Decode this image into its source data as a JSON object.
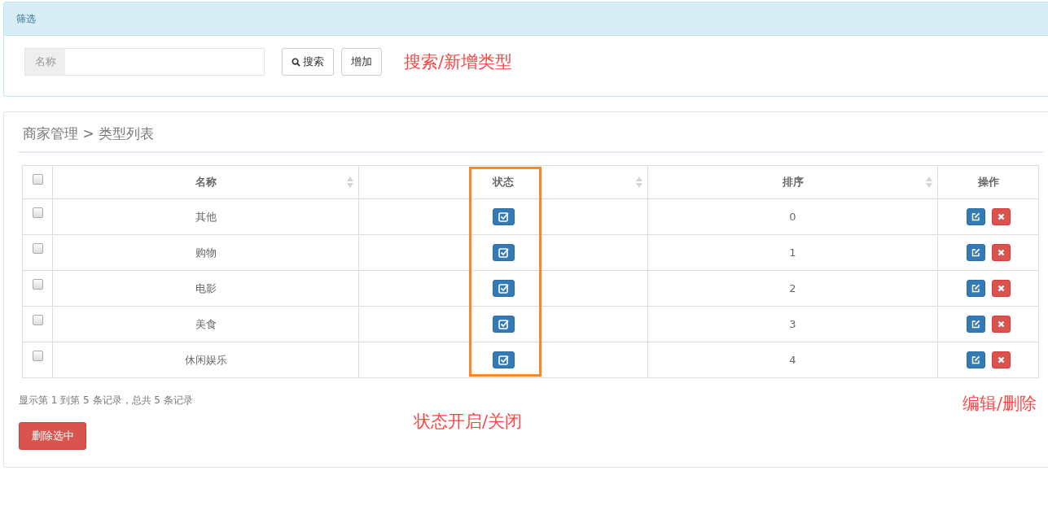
{
  "filter_panel": {
    "title": "筛选",
    "name_field": {
      "label": "名称"
    },
    "buttons": [
      {
        "kind": "search",
        "label": "搜索"
      },
      {
        "kind": "plain",
        "label": "增加"
      }
    ],
    "annotation": "搜索/新增类型"
  },
  "list_panel": {
    "breadcrumb": "商家管理 > 类型列表",
    "table": {
      "select_all": {
        "checked": false
      },
      "columns": [
        {
          "label": "名称",
          "sortable": true
        },
        {
          "label": "状态",
          "sortable": true
        },
        {
          "label": "排序",
          "sortable": true
        },
        {
          "label": "操作",
          "sortable": false
        }
      ],
      "rows": [
        {
          "checked": false,
          "name": "其他",
          "status_on": true,
          "sort": "0"
        },
        {
          "checked": false,
          "name": "购物",
          "status_on": true,
          "sort": "1"
        },
        {
          "checked": false,
          "name": "电影",
          "status_on": true,
          "sort": "2"
        },
        {
          "checked": false,
          "name": "美食",
          "status_on": true,
          "sort": "3"
        },
        {
          "checked": false,
          "name": "休闲娱乐",
          "status_on": true,
          "sort": "4"
        }
      ]
    },
    "summary": "显示第 1 到第 5 条记录，总共 5 条记录",
    "delete_button": "删除选中",
    "status_annotation": "状态开启/关闭",
    "actions_annotation": "编辑/删除"
  }
}
